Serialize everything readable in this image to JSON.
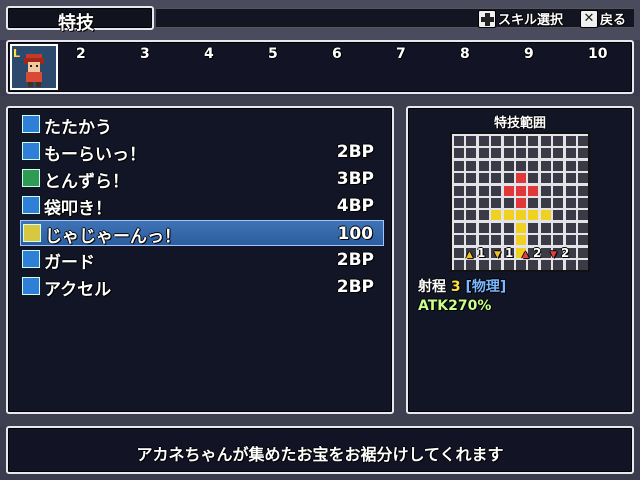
{
  "header": {
    "title": "特技",
    "hint_select": "スキル選択",
    "hint_back": "戻る"
  },
  "party_bar": {
    "slot_badge": "L",
    "slot_numbers": [
      "2",
      "3",
      "4",
      "5",
      "6",
      "7",
      "8",
      "9",
      "10"
    ]
  },
  "skills": [
    {
      "name": "たたかう",
      "cost": "",
      "icon": "sword-icon",
      "icon_color": "#2f7fd8"
    },
    {
      "name": "もーらいっ！",
      "cost": "2BP",
      "icon": "skill-icon",
      "icon_color": "#2f7fd8"
    },
    {
      "name": "とんずら！",
      "cost": "3BP",
      "icon": "plus-icon",
      "icon_color": "#2f9a52"
    },
    {
      "name": "袋叩き！",
      "cost": "4BP",
      "icon": "skill-icon",
      "icon_color": "#2f7fd8"
    },
    {
      "name": "じゃじゃーんっ！",
      "cost": "100",
      "icon": "treasure-icon",
      "icon_color": "#d8c840",
      "selected": true
    },
    {
      "name": "ガード",
      "cost": "2BP",
      "icon": "da-icon",
      "icon_color": "#2f7fd8"
    },
    {
      "name": "アクセル",
      "cost": "2BP",
      "icon": "da-icon",
      "icon_color": "#2f7fd8"
    }
  ],
  "range_panel": {
    "title": "特技範囲",
    "mods": [
      {
        "value": "1",
        "arrow": "up",
        "color": "#f0c020"
      },
      {
        "value": "1",
        "arrow": "down",
        "color": "#f0c020"
      },
      {
        "value": "2",
        "arrow": "up",
        "color": "#e04040"
      },
      {
        "value": "2",
        "arrow": "down",
        "color": "#e04040"
      }
    ],
    "range_label": "射程",
    "range_value": "3",
    "range_type": "物理",
    "atk": "ATK270%"
  },
  "message": "アカネちゃんが集めたお宝をお裾分けしてくれます",
  "colors": {
    "grid_red": "#e03838",
    "grid_yellow": "#f0d020",
    "accent_blue": "#7ab8ff"
  }
}
